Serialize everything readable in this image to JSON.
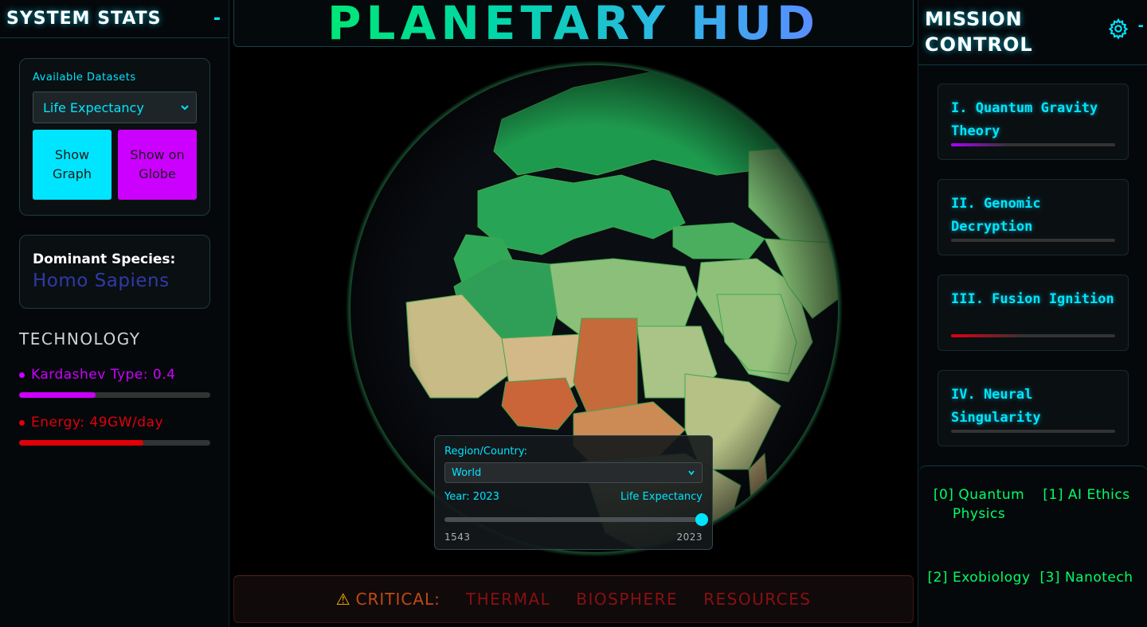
{
  "left_panel": {
    "title": "SYSTEM STATS",
    "collapse_label": "-",
    "datasets": {
      "label": "Available Datasets",
      "selected": "Life Expectancy",
      "show_graph_label": "Show Graph",
      "show_globe_label": "Show on Globe"
    },
    "species": {
      "label": "Dominant Species:",
      "value": "Homo Sapiens"
    },
    "technology": {
      "title": "TECHNOLOGY",
      "stats": [
        {
          "label": "Kardashev Type: 0.4",
          "color": "#cc00ff",
          "fraction": 0.4
        },
        {
          "label": "Energy: 49GW/day",
          "color": "#e0000a",
          "fraction": 0.65
        }
      ]
    }
  },
  "header": {
    "title": "PLANETARY HUD"
  },
  "region_panel": {
    "label": "Region/Country:",
    "selected": "World",
    "year_label": "Year: 2023",
    "dataset_label": "Life Expectancy",
    "slider_min": "1543",
    "slider_max": "2023",
    "slider_value": 2023
  },
  "alerts": {
    "critical_label": "CRITICAL:",
    "items": [
      "THERMAL",
      "BIOSPHERE",
      "RESOURCES"
    ]
  },
  "right_panel": {
    "title": "MISSION CONTROL",
    "settings_icon": "gear-icon",
    "collapse_label": "-",
    "missions": [
      {
        "label": "I. Quantum Gravity Theory",
        "progress": 0.35,
        "color": "#aa00ff"
      },
      {
        "label": "II. Genomic Decryption",
        "progress": 0.0,
        "color": "#00e5ff"
      },
      {
        "label": "III. Fusion Ignition",
        "progress": 0.45,
        "color": "#e00010"
      },
      {
        "label": "IV. Neural Singularity",
        "progress": 0.0,
        "color": "#00e5ff"
      }
    ],
    "topics": [
      {
        "label": "[0] Quantum Physics"
      },
      {
        "label": "[1] AI Ethics"
      },
      {
        "label": "[2] Exobiology"
      },
      {
        "label": "[3] Nanotech"
      }
    ]
  },
  "colors": {
    "accent": "#00e5ff",
    "magenta": "#cc00ff",
    "alert_red": "#8a1010",
    "topic_green": "#00ff66"
  }
}
